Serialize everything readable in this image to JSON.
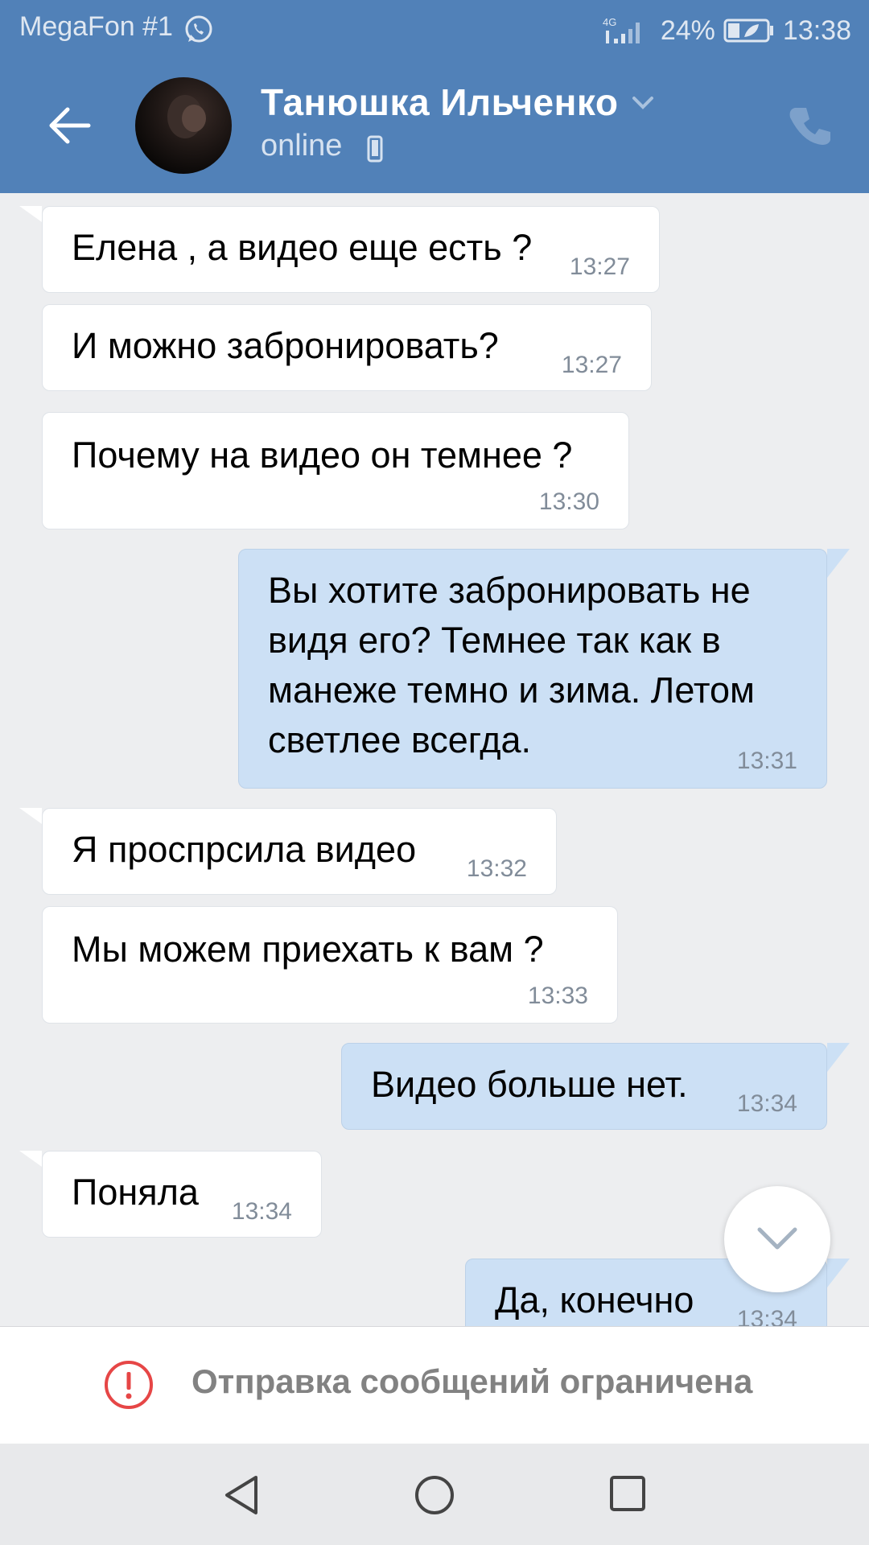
{
  "status_bar": {
    "carrier": "MegaFon #1",
    "network": "4G",
    "battery": "24%",
    "time": "13:38"
  },
  "header": {
    "contact_name": "Танюшка Ильченко",
    "status": "online"
  },
  "messages": [
    {
      "text": "Елена , а видео еще есть ?",
      "time": "13:27"
    },
    {
      "text": "И можно забронировать?",
      "time": "13:27"
    },
    {
      "text": "Почему на видео он темнее ?",
      "time": "13:30"
    },
    {
      "lines": [
        "Вы хотите забронировать не",
        "видя его? Темнее так как в",
        "манеже темно и зима. Летом",
        "светлее всегда."
      ],
      "time": "13:31"
    },
    {
      "text": "Я проспрсила видео",
      "time": "13:32"
    },
    {
      "text": "Мы можем приехать к вам ?",
      "time": "13:33"
    },
    {
      "text": "Видео больше нет.",
      "time": "13:34"
    },
    {
      "text": "Поняла",
      "time": "13:34"
    },
    {
      "text": "Да, конечно",
      "time": "13:34"
    }
  ],
  "restriction": {
    "text": "Отправка сообщений ограничена"
  },
  "colors": {
    "header": "#5181b8",
    "background": "#edeef0",
    "incoming": "#ffffff",
    "outgoing": "#cce0f5",
    "warning": "#e64646"
  }
}
